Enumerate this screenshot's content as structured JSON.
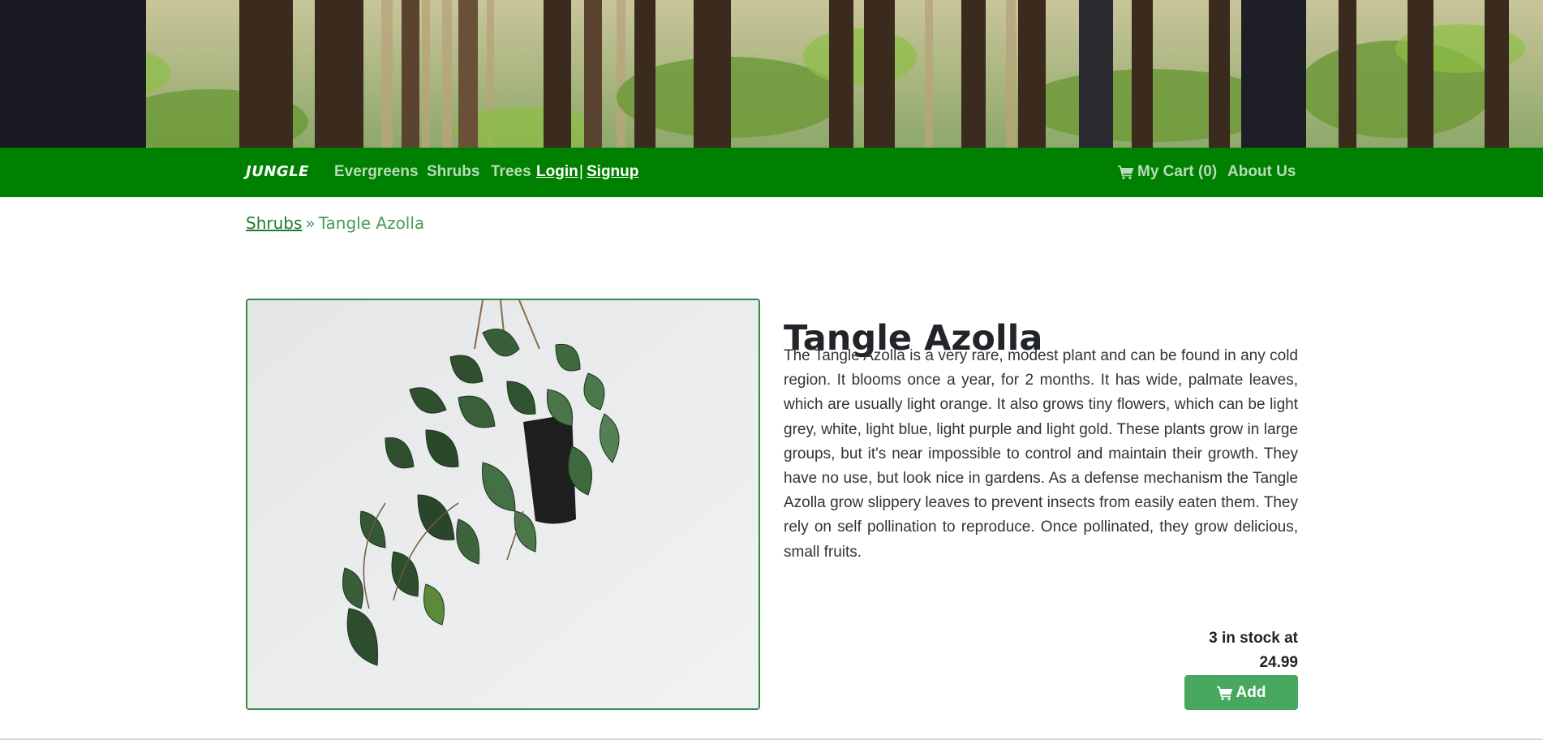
{
  "navbar": {
    "brand": "JUNGLE",
    "links": [
      {
        "label": "Evergreens"
      },
      {
        "label": "Shrubs"
      },
      {
        "label": "Trees"
      }
    ],
    "login_label": "Login",
    "separator": "|",
    "signup_label": "Signup",
    "cart_label": "My Cart (0)",
    "about_label": "About Us",
    "cart_icon": "cart-icon",
    "background_color": "#008000"
  },
  "breadcrumb": {
    "parent": "Shrubs",
    "separator": "»",
    "current": "Tangle Azolla"
  },
  "product": {
    "image_alt": "Hanging potted plant",
    "title": "Tangle Azolla",
    "description": "The Tangle Azolla is a very rare, modest plant and can be found in any cold region. It blooms once a year, for 2 months. It has wide, palmate leaves, which are usually light orange. It also grows tiny flowers, which can be light grey, white, light blue, light purple and light gold. These plants grow in large groups, but it's near impossible to control and maintain their growth. They have no use, but look nice in gardens. As a defense mechanism the Tangle Azolla grow slippery leaves to prevent insects from easily eaten them. They rely on self pollination to reproduce. Once pollinated, they grow delicious, small fruits.",
    "stock_text": "3 in stock at",
    "price": "24.99",
    "add_button_label": "Add",
    "accent_color": "#48a860"
  }
}
